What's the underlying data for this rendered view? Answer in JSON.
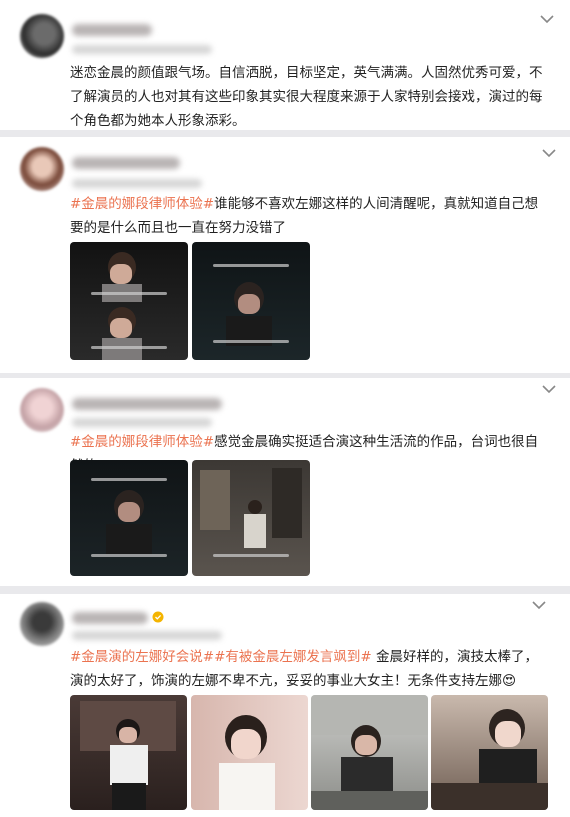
{
  "posts": [
    {
      "text": "迷恋金晨的颜值跟气场。自信洒脱，目标坚定，英气满满。人固然优秀可爱，不了解演员的人也对其有这些印象其实很大程度来源于人家特别会接戏，演过的每个角色都为她本人形象添彩。"
    },
    {
      "tag": "#金晨的娜段律师体验#",
      "text": "谁能够不喜欢左娜这样的人间清醒呢，真就知道自己想要的是什么而且也一直在努力没错了"
    },
    {
      "tag": "#金晨的娜段律师体验#",
      "text": "感觉金晨确实挺适合演这种生活流的作品，台词也很自然的"
    },
    {
      "tag": "#金晨演的左娜好会说##有被金晨左娜发言飒到#",
      "text": " 金晨好样的，演技太棒了，演的太好了，饰演的左娜不卑不亢，妥妥的事业大女主！无条件支持左娜",
      "emoji": "😍"
    }
  ],
  "colors": {
    "tag": "#eb7350",
    "text": "#222222",
    "background": "#e9e9ec"
  }
}
